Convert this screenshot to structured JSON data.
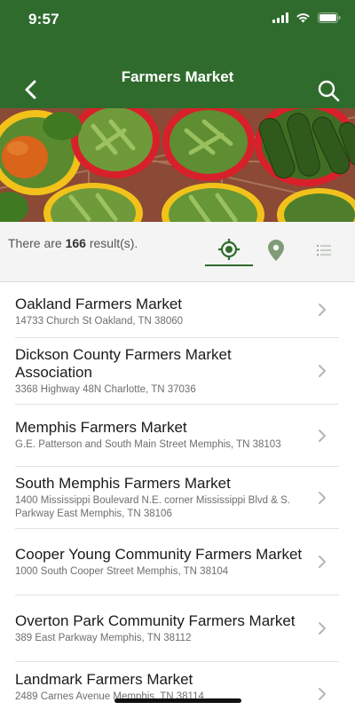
{
  "status_bar": {
    "time": "9:57"
  },
  "header": {
    "title": "Farmers Market",
    "back_icon": "chevron-left-icon",
    "search_icon": "search-icon"
  },
  "filter": {
    "prefix": "There are",
    "count": "166",
    "suffix": "result(s).",
    "tabs": [
      {
        "name": "nearby",
        "icon": "location-target-icon",
        "active": true
      },
      {
        "name": "map",
        "icon": "map-pin-icon",
        "active": false
      },
      {
        "name": "list",
        "icon": "list-icon",
        "active": false
      }
    ]
  },
  "markets": [
    {
      "name": "Oakland Farmers Market",
      "address": "14733 Church St Oakland, TN 38060"
    },
    {
      "name": "Dickson County Farmers Market Association",
      "address": "3368 Highway 48N Charlotte, TN 37036"
    },
    {
      "name": "Memphis Farmers Market",
      "address": "G.E. Patterson and South Main Street Memphis, TN 38103"
    },
    {
      "name": "South Memphis Farmers Market",
      "address": "1400 Mississippi Boulevard N.E. corner Mississippi Blvd & S. Parkway East Memphis, TN 38106"
    },
    {
      "name": "Cooper Young Community Farmers Market",
      "address": "1000 South Cooper Street Memphis, TN 38104"
    },
    {
      "name": "Overton Park Community Farmers Market",
      "address": "389 East Parkway Memphis, TN 38112"
    },
    {
      "name": "Landmark Farmers Market",
      "address": "2489 Carnes Avenue Memphis, TN 38114"
    }
  ],
  "colors": {
    "brand_green": "#2f6b2d",
    "map_pin_green": "#7f9c76"
  }
}
